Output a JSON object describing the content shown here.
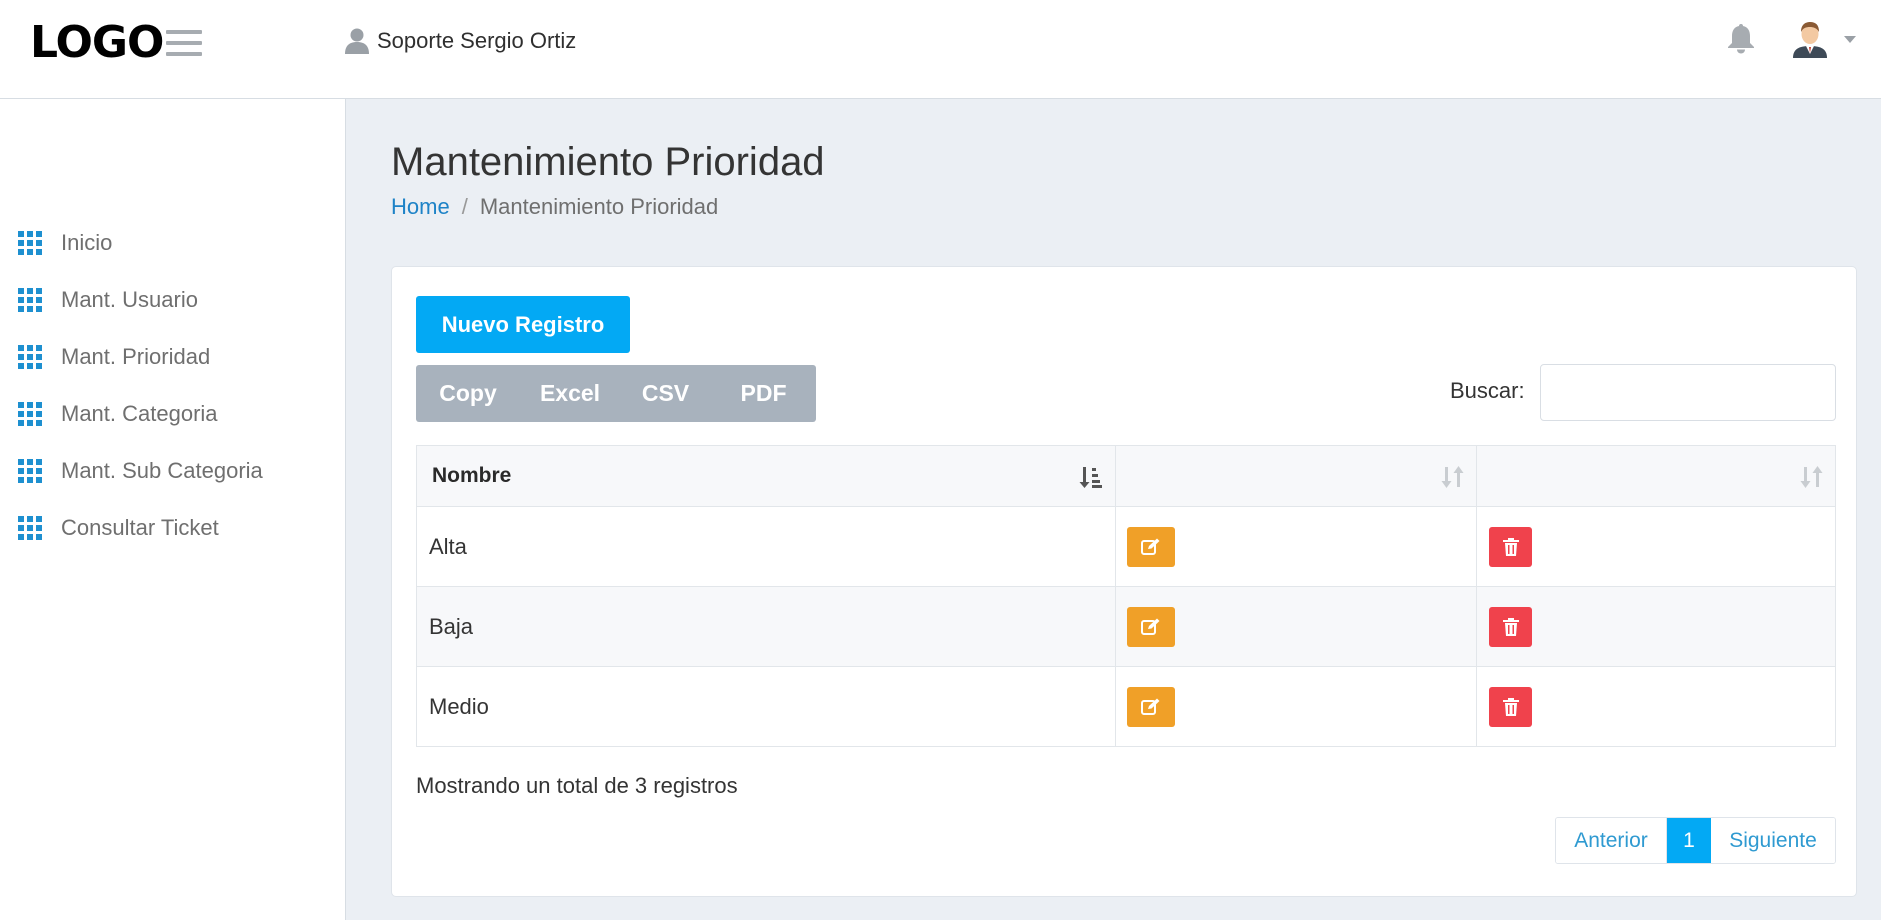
{
  "header": {
    "logo": "LOGO",
    "user_name": "Soporte Sergio Ortiz"
  },
  "sidebar": {
    "items": [
      {
        "label": "Inicio"
      },
      {
        "label": "Mant. Usuario"
      },
      {
        "label": "Mant. Prioridad"
      },
      {
        "label": "Mant. Categoria"
      },
      {
        "label": "Mant. Sub Categoria"
      },
      {
        "label": "Consultar Ticket"
      }
    ]
  },
  "main": {
    "title": "Mantenimiento Prioridad",
    "breadcrumb": {
      "home": "Home",
      "separator": "/",
      "current": "Mantenimiento Prioridad"
    },
    "new_button": "Nuevo Registro",
    "export_buttons": [
      "Copy",
      "Excel",
      "CSV",
      "PDF"
    ],
    "search": {
      "label": "Buscar:",
      "value": ""
    },
    "table": {
      "columns": [
        "Nombre",
        "",
        ""
      ],
      "rows": [
        {
          "nombre": "Alta"
        },
        {
          "nombre": "Baja"
        },
        {
          "nombre": "Medio"
        }
      ]
    },
    "info": "Mostrando un total de 3 registros",
    "pagination": {
      "prev": "Anterior",
      "current": "1",
      "next": "Siguiente"
    }
  },
  "colors": {
    "primary": "#03a9f4",
    "edit": "#f0a028",
    "delete": "#f0424c",
    "sidebar_icon": "#1e90d0",
    "export_bg": "#a8b2bd"
  },
  "icons": {
    "menu": "hamburger-icon",
    "user": "user-icon",
    "bell": "bell-icon",
    "sidebar": "grid-icon",
    "edit": "edit-icon",
    "delete": "trash-icon",
    "sort": "sort-icon"
  }
}
